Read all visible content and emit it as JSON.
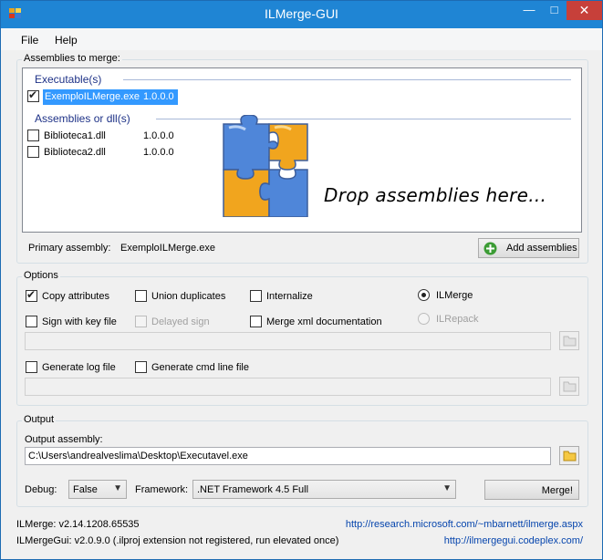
{
  "window": {
    "title": "ILMerge-GUI"
  },
  "menu": {
    "file": "File",
    "help": "Help"
  },
  "assemblies": {
    "group_title": "Assemblies to merge:",
    "executable_header": "Executable(s)",
    "executables": [
      {
        "name": "ExemploILMerge.exe",
        "version": "1.0.0.0",
        "checked": true
      }
    ],
    "dll_header": "Assemblies or dll(s)",
    "dlls": [
      {
        "name": "Biblioteca1.dll",
        "version": "1.0.0.0",
        "checked": false
      },
      {
        "name": "Biblioteca2.dll",
        "version": "1.0.0.0",
        "checked": false
      }
    ],
    "drop_hint": "Drop assemblies here...",
    "primary_label": "Primary assembly:",
    "primary_value": "ExemploILMerge.exe",
    "add_button": "Add assemblies"
  },
  "options": {
    "group_title": "Options",
    "copy_attributes": "Copy attributes",
    "union_duplicates": "Union duplicates",
    "internalize": "Internalize",
    "sign_with_key": "Sign with key file",
    "delayed_sign": "Delayed sign",
    "merge_xml": "Merge xml documentation",
    "ilmerge": "ILMerge",
    "ilrepack": "ILRepack",
    "generate_log": "Generate log file",
    "generate_cmd": "Generate cmd line file"
  },
  "output": {
    "group_title": "Output",
    "output_label": "Output assembly:",
    "output_value": "C:\\Users\\andrealveslima\\Desktop\\Executavel.exe",
    "debug_label": "Debug:",
    "debug_value": "False",
    "framework_label": "Framework:",
    "framework_value": ".NET Framework 4.5 Full",
    "merge_button": "Merge!"
  },
  "footer": {
    "ilmerge_version": "ILMerge: v2.14.1208.65535",
    "ilmergegui_version": "ILMergeGui: v2.0.9.0 (.ilproj extension not registered, run elevated once)",
    "link_ilmerge": "http://research.microsoft.com/~mbarnett/ilmerge.aspx",
    "link_gui": "http://ilmergegui.codeplex.com/"
  },
  "colors": {
    "titlebar": "#1f85d4",
    "selection": "#3399ff",
    "link": "#0645ad",
    "close": "#c7403a"
  }
}
